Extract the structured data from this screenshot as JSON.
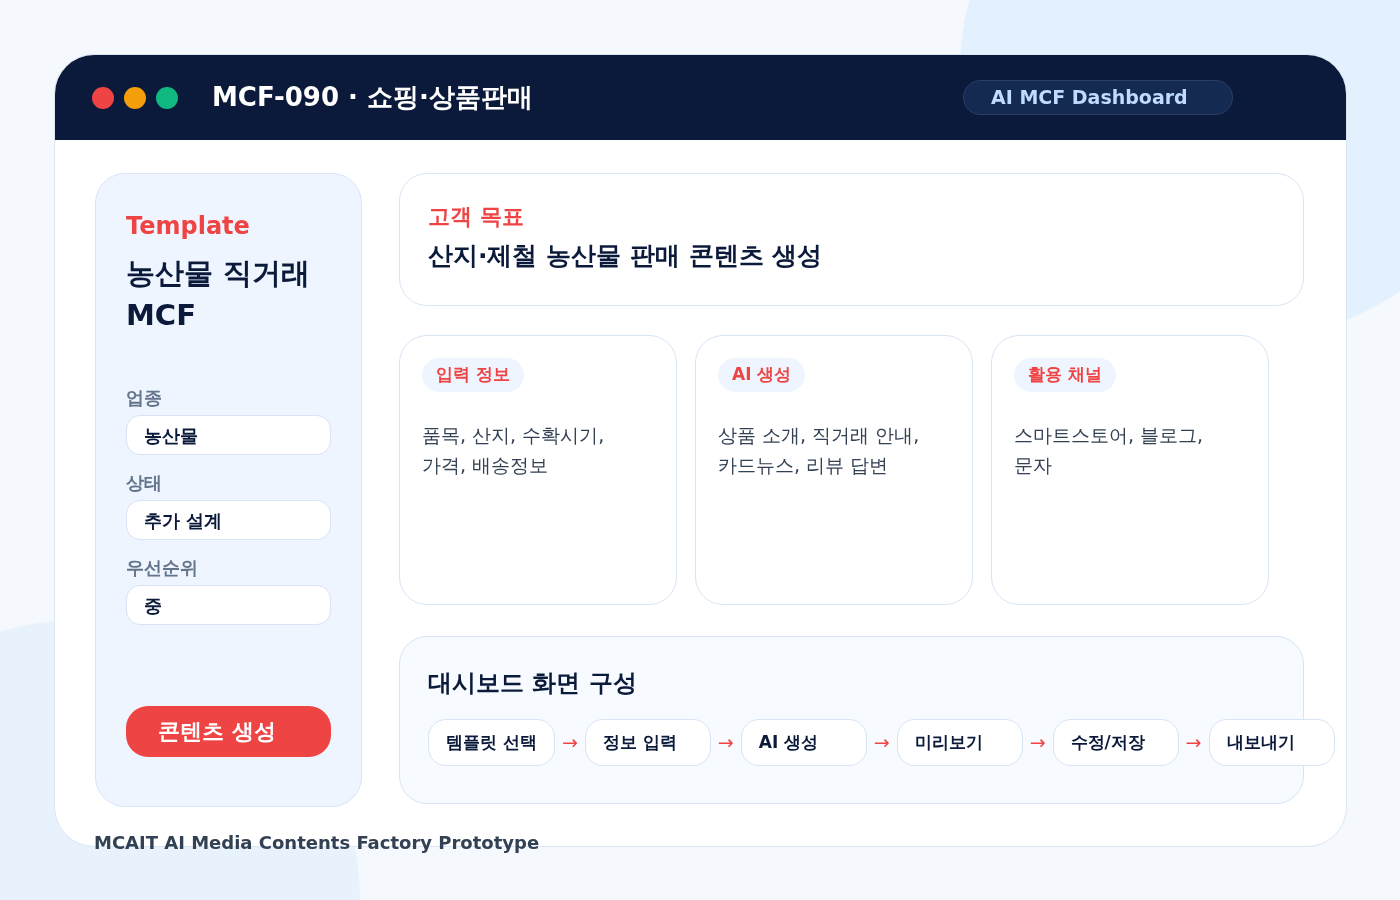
{
  "window": {
    "title": "MCF-090 · 쇼핑·상품판매",
    "badge": "AI MCF Dashboard"
  },
  "sidebar": {
    "eyebrow": "Template",
    "title": "농산물 직거래\nMCF",
    "fields": [
      {
        "label": "업종",
        "value": "농산물"
      },
      {
        "label": "상태",
        "value": "추가 설계"
      },
      {
        "label": "우선순위",
        "value": "중"
      }
    ],
    "button": "콘텐츠 생성"
  },
  "goal": {
    "label": "고객 목표",
    "text": "산지·제철 농산물 판매 콘텐츠 생성"
  },
  "cards": [
    {
      "tag": "입력 정보",
      "text": "품목, 산지, 수확시기,\n가격, 배송정보"
    },
    {
      "tag": "AI 생성",
      "text": "상품 소개, 직거래 안내,\n카드뉴스, 리뷰 답변"
    },
    {
      "tag": "활용 채널",
      "text": "스마트스토어, 블로그,\n문자"
    }
  ],
  "flow": {
    "title": "대시보드 화면 구성",
    "steps": [
      {
        "label": "템플릿 선택",
        "arrow": "→"
      },
      {
        "label": "정보 입력",
        "arrow": "→"
      },
      {
        "label": "AI 생성",
        "arrow": "→"
      },
      {
        "label": "미리보기",
        "arrow": "→"
      },
      {
        "label": "수정/저장",
        "arrow": "→"
      },
      {
        "label": "내보내기"
      }
    ]
  },
  "footer": "MCAIT AI Media Contents Factory Prototype"
}
